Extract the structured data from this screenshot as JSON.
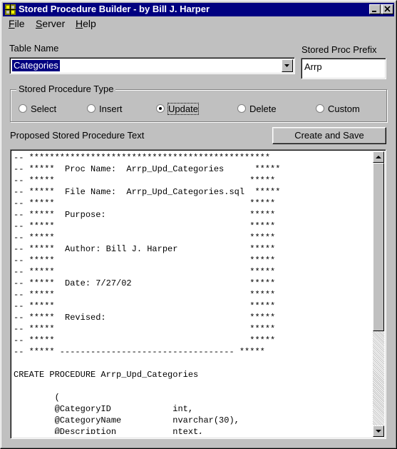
{
  "window": {
    "title": "Stored Procedure Builder - by Bill J. Harper",
    "icon": "app-icon",
    "caption_buttons": [
      "minimize-icon",
      "maximize-icon",
      "close-icon"
    ]
  },
  "menu": {
    "items": [
      {
        "label": "File",
        "accel": "F",
        "rest": "ile"
      },
      {
        "label": "Server",
        "accel": "S",
        "rest": "erver"
      },
      {
        "label": "Help",
        "accel": "H",
        "rest": "elp"
      }
    ]
  },
  "table_name": {
    "label": "Table Name",
    "value": "Categories"
  },
  "prefix": {
    "label": "Stored Proc Prefix",
    "value": "Arrp"
  },
  "proc_type": {
    "caption": "Stored Procedure Type",
    "options": [
      {
        "label": "Select",
        "checked": false
      },
      {
        "label": "Insert",
        "checked": false
      },
      {
        "label": "Update",
        "checked": true
      },
      {
        "label": "Delete",
        "checked": false
      },
      {
        "label": "Custom",
        "checked": false
      }
    ]
  },
  "proposed": {
    "label": "Proposed Stored Procedure Text",
    "button": "Create and Save",
    "lines": [
      "-- ***********************************************",
      "-- *****  Proc Name:  Arrp_Upd_Categories      *****",
      "-- *****                                      *****",
      "-- *****  File Name:  Arrp_Upd_Categories.sql  *****",
      "-- *****                                      *****",
      "-- *****  Purpose:                            *****",
      "-- *****                                      *****",
      "-- *****                                      *****",
      "-- *****  Author: Bill J. Harper              *****",
      "-- *****                                      *****",
      "-- *****                                      *****",
      "-- *****  Date: 7/27/02                       *****",
      "-- *****                                      *****",
      "-- *****                                      *****",
      "-- *****  Revised:                            *****",
      "-- *****                                      *****",
      "-- *****                                      *****",
      "-- ***** ---------------------------------- *****",
      "",
      "CREATE PROCEDURE Arrp_Upd_Categories",
      "",
      "        (",
      "        @CategoryID            int,",
      "        @CategoryName          nvarchar(30),",
      "        @Description           ntext,"
    ]
  }
}
